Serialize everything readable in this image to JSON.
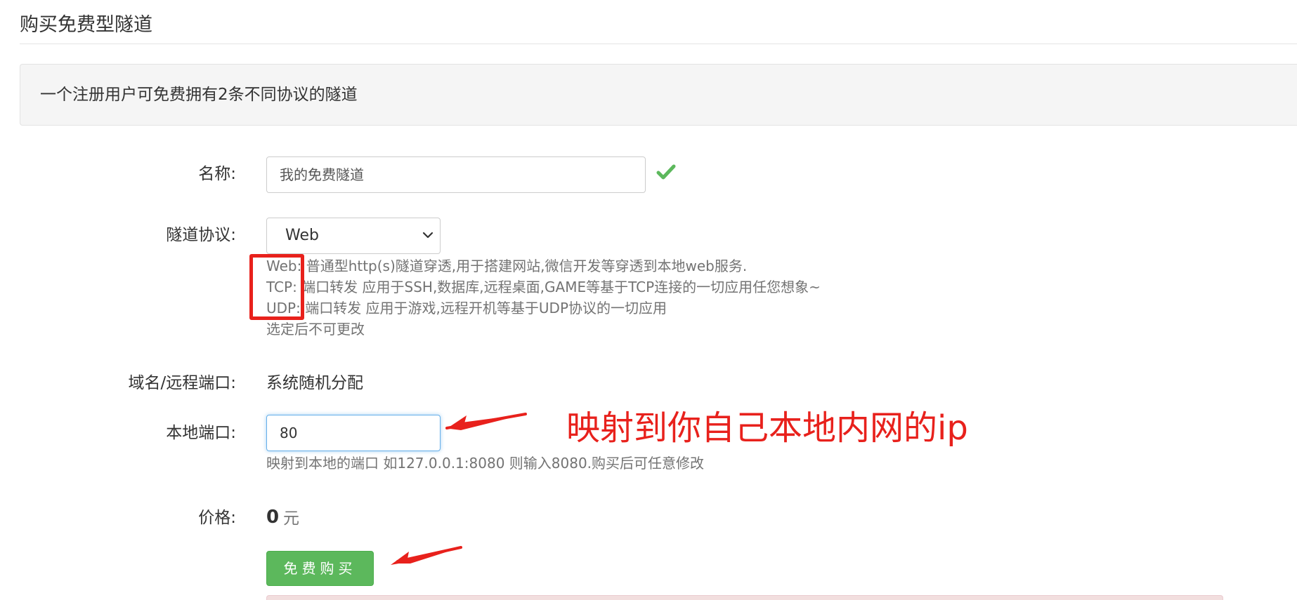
{
  "page": {
    "title": "购买免费型隧道"
  },
  "notice": {
    "text": "一个注册用户可免费拥有2条不同协议的隧道"
  },
  "form": {
    "name": {
      "label": "名称:",
      "value": "我的免费隧道"
    },
    "protocol": {
      "label": "隧道协议:",
      "selected": "Web",
      "help": [
        "Web: 普通型http(s)隧道穿透,用于搭建网站,微信开发等穿透到本地web服务.",
        "TCP: 端口转发 应用于SSH,数据库,远程桌面,GAME等基于TCP连接的一切应用任您想象~",
        "UDP: 端口转发 应用于游戏,远程开机等基于UDP协议的一切应用",
        "选定后不可更改"
      ]
    },
    "domain_port": {
      "label": "域名/远程端口:",
      "value": "系统随机分配"
    },
    "local_port": {
      "label": "本地端口:",
      "value": "80",
      "help": "映射到本地的端口 如127.0.0.1:8080 则输入8080.购买后可任意修改"
    },
    "price": {
      "label": "价格:",
      "value": "0",
      "unit": "元"
    },
    "submit_label": "免费购买"
  },
  "annotation": {
    "text": "映射到你自己本地内网的ip"
  },
  "colors": {
    "annotation_red": "#e8211c",
    "button_green": "#5cb85c",
    "check_green": "#5cb85c",
    "focus_blue": "#66afe9"
  },
  "icons": {
    "valid": "check-icon",
    "select": "chevron-down-icon"
  }
}
